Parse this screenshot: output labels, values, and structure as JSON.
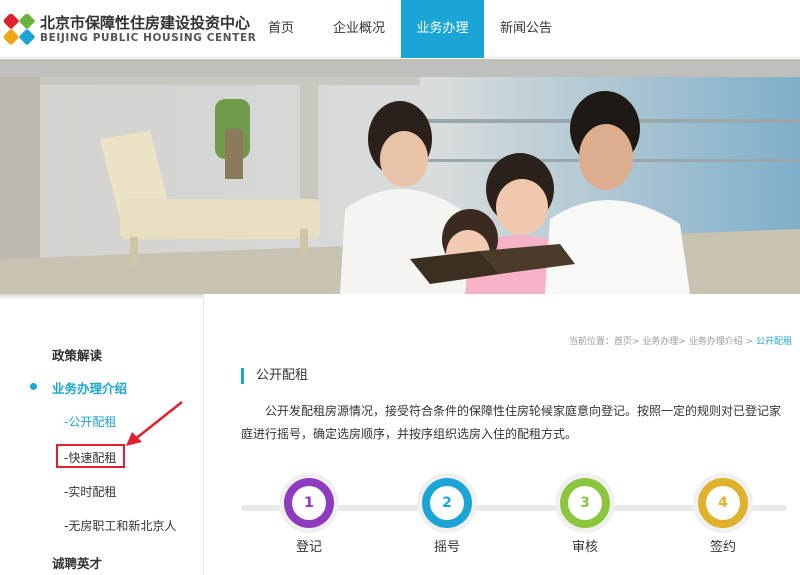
{
  "header": {
    "logo_cn": "北京市保障性住房建设投资中心",
    "logo_en": "BEIJING PUBLIC HOUSING CENTER",
    "nav": [
      {
        "label": "首页",
        "active": false
      },
      {
        "label": "企业概况",
        "active": false
      },
      {
        "label": "业务办理",
        "active": true
      },
      {
        "label": "新闻公告",
        "active": false
      }
    ],
    "accent_color": "#1ba5d6"
  },
  "sidebar": {
    "items": [
      {
        "label": "政策解读"
      },
      {
        "label": "业务办理介绍"
      },
      {
        "label": "诚聘英才"
      }
    ],
    "sub_items": [
      {
        "label": "-公开配租"
      },
      {
        "label": "-快速配租"
      },
      {
        "label": "-实时配租"
      },
      {
        "label": "-无房职工和新北京人"
      }
    ]
  },
  "main": {
    "breadcrumb_prefix": "当前位置：首页> 业务办理> 业务办理介绍 >",
    "breadcrumb_current": "公开配租",
    "section_title": "公开配租",
    "intro": "公开发配租房源情况，接受符合条件的保障性住房轮候家庭意向登记。按照一定的规则对已登记家庭进行摇号，确定选房顺序，并按序组织选房入住的配租方式。",
    "steps": [
      {
        "number": "1",
        "label": "登记",
        "color": "#8e3bbf"
      },
      {
        "number": "2",
        "label": "摇号",
        "color": "#1ba5d6"
      },
      {
        "number": "3",
        "label": "审核",
        "color": "#8cc63f"
      },
      {
        "number": "4",
        "label": "签约",
        "color": "#e0b12a"
      }
    ]
  },
  "annotation_color": "#e0202c"
}
